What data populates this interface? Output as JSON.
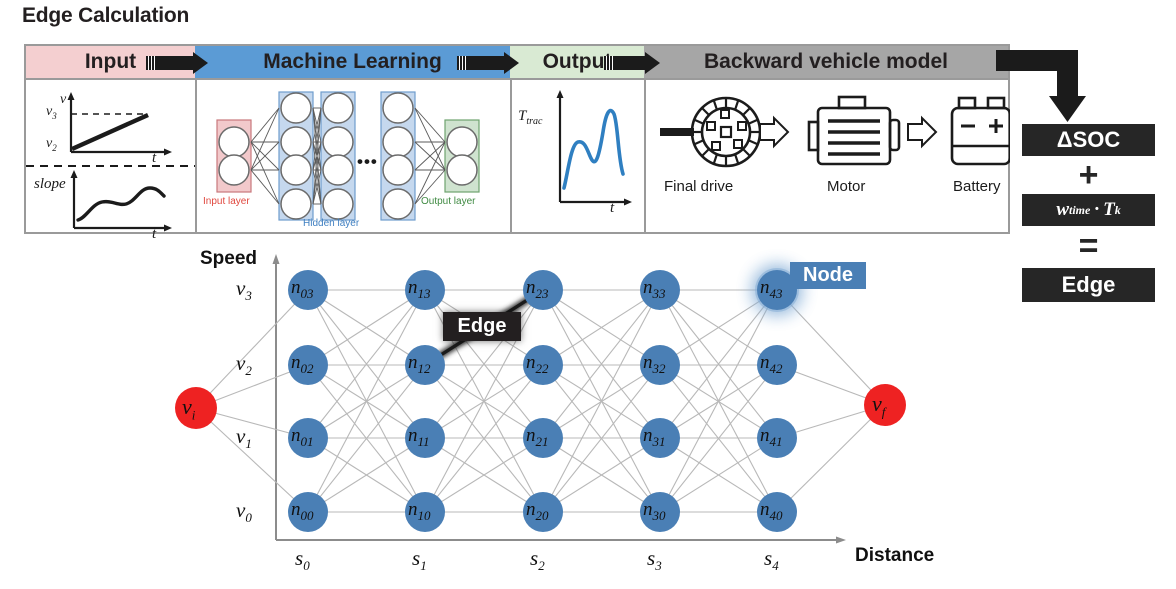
{
  "title": "Edge Calculation",
  "pipeline": {
    "stages": [
      {
        "label": "Input",
        "color": "#f4cfd0"
      },
      {
        "label": "Machine Learning",
        "color": "#5b9bd5"
      },
      {
        "label": "Output",
        "color": "#d9ead3"
      },
      {
        "label": "Backward vehicle model",
        "color": "#a6a6a6"
      }
    ],
    "input_panel": {
      "graph1": {
        "ylabel": "v",
        "ytick_high": "v_3",
        "ytick_low": "v_2",
        "xlabel": "t"
      },
      "graph2": {
        "ylabel": "slope",
        "xlabel": "t"
      }
    },
    "ml_panel": {
      "input_layer_label": "Input layer",
      "hidden_layer_label": "Hidden layer",
      "output_layer_label": "Output layer",
      "ellipsis": "•••",
      "input_color": "#e8979b",
      "hidden_color": "#4a86c8",
      "output_color": "#7ab87a"
    },
    "output_panel": {
      "ylabel": "T_trac",
      "xlabel": "t",
      "curve_color": "#2f7fc1"
    },
    "vehicle_panel": {
      "items": [
        {
          "icon": "final-drive-icon",
          "label": "Final drive"
        },
        {
          "icon": "motor-icon",
          "label": "Motor"
        },
        {
          "icon": "battery-icon",
          "label": "Battery"
        }
      ],
      "battery_minus": "−",
      "battery_plus": "+"
    }
  },
  "equation": {
    "term1": "ΔSOC",
    "op1": "+",
    "term2_w": "w",
    "term2_wsub": "time",
    "term2_dot": "·",
    "term2_t": "T",
    "term2_tsub": "k",
    "op2": "=",
    "result": "Edge",
    "box_color": "#262626"
  },
  "trellis": {
    "y_axis_label": "Speed",
    "x_axis_label": "Distance",
    "speed_ticks": [
      "v_3",
      "v_2",
      "v_1",
      "v_0"
    ],
    "distance_ticks": [
      "s_0",
      "s_1",
      "s_2",
      "s_3",
      "s_4"
    ],
    "start_node": {
      "v": "v",
      "sub": "i"
    },
    "end_node": {
      "v": "v",
      "sub": "f"
    },
    "node_color": "#4a7fb5",
    "endpoint_color": "#ee2222",
    "callouts": [
      {
        "name": "edge-callout",
        "label": "Edge",
        "bg": "#231f20"
      },
      {
        "name": "node-callout",
        "label": "Node",
        "bg": "#4a7fb5"
      }
    ],
    "nodes": [
      {
        "id": "n_00",
        "col": 0,
        "row": 0
      },
      {
        "id": "n_01",
        "col": 0,
        "row": 1
      },
      {
        "id": "n_02",
        "col": 0,
        "row": 2
      },
      {
        "id": "n_03",
        "col": 0,
        "row": 3
      },
      {
        "id": "n_10",
        "col": 1,
        "row": 0
      },
      {
        "id": "n_11",
        "col": 1,
        "row": 1
      },
      {
        "id": "n_12",
        "col": 1,
        "row": 2
      },
      {
        "id": "n_13",
        "col": 1,
        "row": 3
      },
      {
        "id": "n_20",
        "col": 2,
        "row": 0
      },
      {
        "id": "n_21",
        "col": 2,
        "row": 1
      },
      {
        "id": "n_22",
        "col": 2,
        "row": 2
      },
      {
        "id": "n_23",
        "col": 2,
        "row": 3
      },
      {
        "id": "n_30",
        "col": 3,
        "row": 0
      },
      {
        "id": "n_31",
        "col": 3,
        "row": 1
      },
      {
        "id": "n_32",
        "col": 3,
        "row": 2
      },
      {
        "id": "n_33",
        "col": 3,
        "row": 3
      },
      {
        "id": "n_40",
        "col": 4,
        "row": 0
      },
      {
        "id": "n_41",
        "col": 4,
        "row": 1
      },
      {
        "id": "n_42",
        "col": 4,
        "row": 2
      },
      {
        "id": "n_43",
        "col": 4,
        "row": 3
      }
    ]
  }
}
